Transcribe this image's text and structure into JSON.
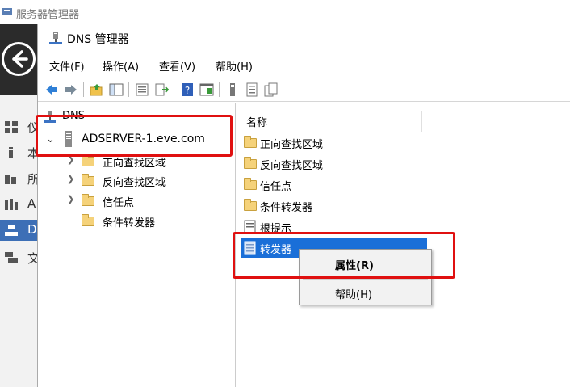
{
  "server_manager": {
    "title": "服务器管理器",
    "nav": [
      {
        "label": "仪",
        "icon": "dashboard-icon"
      },
      {
        "label": "本",
        "icon": "local-server-icon"
      },
      {
        "label": "所",
        "icon": "all-servers-icon"
      },
      {
        "label": "A",
        "icon": "ad-ds-icon"
      },
      {
        "label": "D",
        "icon": "dns-icon",
        "active": true
      },
      {
        "label": "文",
        "icon": "file-services-icon"
      }
    ]
  },
  "dns_window": {
    "title": "DNS 管理器",
    "menus": [
      "文件(F)",
      "操作(A)",
      "查看(V)",
      "帮助(H)"
    ]
  },
  "tree": {
    "root": "DNS",
    "server": "ADSERVER-1.eve.com",
    "children": [
      "正向查找区域",
      "反向查找区域",
      "信任点",
      "条件转发器"
    ]
  },
  "list": {
    "column_name": "名称",
    "items": [
      "正向查找区域",
      "反向查找区域",
      "信任点",
      "条件转发器",
      "根提示",
      "转发器"
    ],
    "selected": "转发器"
  },
  "context_menu": {
    "items": [
      "属性(R)",
      "帮助(H)"
    ]
  },
  "colors": {
    "selection": "#1a6fd8",
    "annotation": "#e01010",
    "active_nav": "#3d6fb6"
  }
}
